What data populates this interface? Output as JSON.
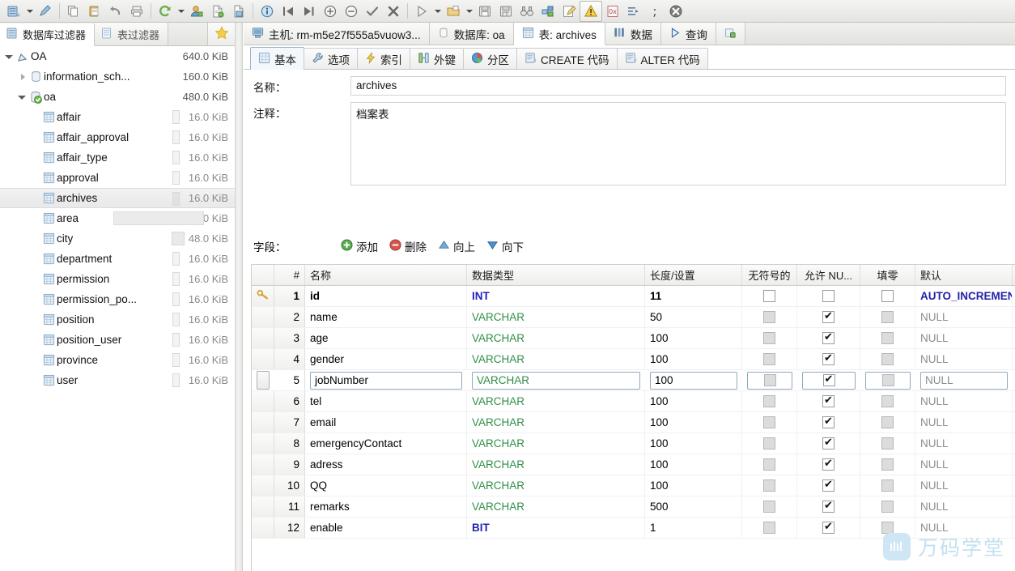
{
  "toolbar": {
    "items": [
      {
        "name": "open-table-icon",
        "glyph": "table"
      },
      {
        "name": "chevron-down-icon",
        "glyph": "caret"
      },
      {
        "name": "design-table-icon",
        "glyph": "pencil-table"
      },
      {
        "name": "separator",
        "glyph": "sep"
      },
      {
        "name": "copy-icon",
        "glyph": "copy"
      },
      {
        "name": "paste-icon",
        "glyph": "paste"
      },
      {
        "name": "undo-icon",
        "glyph": "undo"
      },
      {
        "name": "print-icon",
        "glyph": "print"
      },
      {
        "name": "separator",
        "glyph": "sep"
      },
      {
        "name": "refresh-icon",
        "glyph": "refresh"
      },
      {
        "name": "chevron-down-icon",
        "glyph": "caret"
      },
      {
        "name": "user-manage-icon",
        "glyph": "user"
      },
      {
        "name": "new-document-icon",
        "glyph": "newdoc"
      },
      {
        "name": "save-document-icon",
        "glyph": "savedoc"
      },
      {
        "name": "separator",
        "glyph": "sep"
      },
      {
        "name": "info-icon",
        "glyph": "info"
      },
      {
        "name": "first-record-icon",
        "glyph": "first"
      },
      {
        "name": "last-record-icon",
        "glyph": "last"
      },
      {
        "name": "add-record-icon",
        "glyph": "plus-circle"
      },
      {
        "name": "delete-record-icon",
        "glyph": "minus-circle"
      },
      {
        "name": "apply-changes-icon",
        "glyph": "check"
      },
      {
        "name": "cancel-changes-icon",
        "glyph": "cross"
      },
      {
        "name": "separator",
        "glyph": "sep"
      },
      {
        "name": "run-query-icon",
        "glyph": "play"
      },
      {
        "name": "chevron-down-icon",
        "glyph": "caret"
      },
      {
        "name": "load-query-icon",
        "glyph": "folder"
      },
      {
        "name": "chevron-down-icon",
        "glyph": "caret"
      },
      {
        "name": "save-icon",
        "glyph": "floppy"
      },
      {
        "name": "save-as-icon",
        "glyph": "floppy-as"
      },
      {
        "name": "find-icon",
        "glyph": "binocular"
      },
      {
        "name": "query-builder-icon",
        "glyph": "builder"
      },
      {
        "name": "edit-icon",
        "glyph": "edit"
      },
      {
        "name": "warning-icon",
        "glyph": "warning"
      },
      {
        "name": "hex-icon",
        "glyph": "hex"
      },
      {
        "name": "indent-icon",
        "glyph": "indent"
      },
      {
        "name": "semicolon-icon",
        "glyph": "semi"
      },
      {
        "name": "stop-icon",
        "glyph": "stop"
      }
    ]
  },
  "sidebar": {
    "filter_tabs": [
      {
        "label": "数据库过滤器",
        "icon": "database-filter-icon",
        "active": true
      },
      {
        "label": "表过滤器",
        "icon": "table-filter-icon",
        "active": false
      }
    ],
    "favorite_icon": "star-icon",
    "tree": [
      {
        "label": "OA",
        "size": "640.0 KiB",
        "indent": 0,
        "twist": "open",
        "icon": "connection-icon",
        "selected": false,
        "bar": "none"
      },
      {
        "label": "information_sch...",
        "size": "160.0 KiB",
        "indent": 1,
        "twist": "closed",
        "icon": "database-icon",
        "selected": false,
        "bar": "none"
      },
      {
        "label": "oa",
        "size": "480.0 KiB",
        "indent": 1,
        "twist": "open",
        "icon": "database-open-icon",
        "selected": false,
        "bar": "none"
      },
      {
        "label": "affair",
        "size": "16.0 KiB",
        "indent": 2,
        "twist": "none",
        "icon": "table-icon",
        "selected": false,
        "bar": "thin"
      },
      {
        "label": "affair_approval",
        "size": "16.0 KiB",
        "indent": 2,
        "twist": "none",
        "icon": "table-icon",
        "selected": false,
        "bar": "thin"
      },
      {
        "label": "affair_type",
        "size": "16.0 KiB",
        "indent": 2,
        "twist": "none",
        "icon": "table-icon",
        "selected": false,
        "bar": "thin"
      },
      {
        "label": "approval",
        "size": "16.0 KiB",
        "indent": 2,
        "twist": "none",
        "icon": "table-icon",
        "selected": false,
        "bar": "thin"
      },
      {
        "label": "archives",
        "size": "16.0 KiB",
        "indent": 2,
        "twist": "none",
        "icon": "table-icon",
        "selected": true,
        "bar": "thin"
      },
      {
        "label": "area",
        "size": "240.0 KiB",
        "indent": 2,
        "twist": "none",
        "icon": "table-icon",
        "selected": false,
        "bar": "hilite"
      },
      {
        "label": "city",
        "size": "48.0 KiB",
        "indent": 2,
        "twist": "none",
        "icon": "table-icon",
        "selected": false,
        "bar": "wide"
      },
      {
        "label": "department",
        "size": "16.0 KiB",
        "indent": 2,
        "twist": "none",
        "icon": "table-icon",
        "selected": false,
        "bar": "thin"
      },
      {
        "label": "permission",
        "size": "16.0 KiB",
        "indent": 2,
        "twist": "none",
        "icon": "table-icon",
        "selected": false,
        "bar": "thin"
      },
      {
        "label": "permission_po...",
        "size": "16.0 KiB",
        "indent": 2,
        "twist": "none",
        "icon": "table-icon",
        "selected": false,
        "bar": "thin"
      },
      {
        "label": "position",
        "size": "16.0 KiB",
        "indent": 2,
        "twist": "none",
        "icon": "table-icon",
        "selected": false,
        "bar": "thin"
      },
      {
        "label": "position_user",
        "size": "16.0 KiB",
        "indent": 2,
        "twist": "none",
        "icon": "table-icon",
        "selected": false,
        "bar": "thin"
      },
      {
        "label": "province",
        "size": "16.0 KiB",
        "indent": 2,
        "twist": "none",
        "icon": "table-icon",
        "selected": false,
        "bar": "thin"
      },
      {
        "label": "user",
        "size": "16.0 KiB",
        "indent": 2,
        "twist": "none",
        "icon": "table-icon",
        "selected": false,
        "bar": "thin"
      }
    ]
  },
  "object_tabs": [
    {
      "label": "主机: rm-m5e27f555a5vuow3...",
      "icon": "host-icon",
      "active": false
    },
    {
      "label": "数据库: oa",
      "icon": "database-icon",
      "active": false
    },
    {
      "label": "表: archives",
      "icon": "table-icon",
      "active": true
    },
    {
      "label": "数据",
      "icon": "data-icon",
      "active": false
    },
    {
      "label": "查询",
      "icon": "query-icon",
      "active": false
    },
    {
      "label": "",
      "icon": "new-tab-icon",
      "active": false
    }
  ],
  "designer_tabs": [
    {
      "label": "基本",
      "icon": "grid-icon",
      "active": true
    },
    {
      "label": "选项",
      "icon": "wrench-icon",
      "active": false
    },
    {
      "label": "索引",
      "icon": "lightning-icon",
      "active": false
    },
    {
      "label": "外键",
      "icon": "key-link-icon",
      "active": false
    },
    {
      "label": "分区",
      "icon": "pie-icon",
      "active": false
    },
    {
      "label": "CREATE 代码",
      "icon": "code-icon",
      "active": false
    },
    {
      "label": "ALTER 代码",
      "icon": "code-icon",
      "active": false
    }
  ],
  "form": {
    "name_label": "名称：",
    "name_value": "archives",
    "comment_label": "注释：",
    "comment_value": "档案表"
  },
  "fields_toolbar": {
    "label": "字段：",
    "buttons": [
      {
        "label": "添加",
        "icon": "add-icon"
      },
      {
        "label": "删除",
        "icon": "remove-icon"
      },
      {
        "label": "向上",
        "icon": "move-up-icon"
      },
      {
        "label": "向下",
        "icon": "move-down-icon"
      }
    ]
  },
  "grid": {
    "columns": [
      "",
      "#",
      "名称",
      "数据类型",
      "长度/设置",
      "无符号的",
      "允许 NU...",
      "填零",
      "默认"
    ],
    "rows": [
      {
        "key": true,
        "num": "1",
        "name": "id",
        "type": "INT",
        "type_kind": "int",
        "length": "11",
        "unsigned": "off",
        "nullable": "off",
        "zerofill": "off",
        "default": "AUTO_INCREMENT",
        "default_kind": "autoinc",
        "bold": true,
        "editing": false
      },
      {
        "key": false,
        "num": "2",
        "name": "name",
        "type": "VARCHAR",
        "type_kind": "varchar",
        "length": "50",
        "unsigned": "disabled",
        "nullable": "checked",
        "zerofill": "disabled",
        "default": "NULL",
        "default_kind": "null",
        "bold": false,
        "editing": false
      },
      {
        "key": false,
        "num": "3",
        "name": "age",
        "type": "VARCHAR",
        "type_kind": "varchar",
        "length": "100",
        "unsigned": "disabled",
        "nullable": "checked",
        "zerofill": "disabled",
        "default": "NULL",
        "default_kind": "null",
        "bold": false,
        "editing": false
      },
      {
        "key": false,
        "num": "4",
        "name": "gender",
        "type": "VARCHAR",
        "type_kind": "varchar",
        "length": "100",
        "unsigned": "disabled",
        "nullable": "checked",
        "zerofill": "disabled",
        "default": "NULL",
        "default_kind": "null",
        "bold": false,
        "editing": false
      },
      {
        "key": false,
        "num": "5",
        "name": "jobNumber",
        "type": "VARCHAR",
        "type_kind": "varchar",
        "length": "100",
        "unsigned": "disabled",
        "nullable": "checked",
        "zerofill": "disabled",
        "default": "NULL",
        "default_kind": "null",
        "bold": false,
        "editing": true
      },
      {
        "key": false,
        "num": "6",
        "name": "tel",
        "type": "VARCHAR",
        "type_kind": "varchar",
        "length": "100",
        "unsigned": "disabled",
        "nullable": "checked",
        "zerofill": "disabled",
        "default": "NULL",
        "default_kind": "null",
        "bold": false,
        "editing": false
      },
      {
        "key": false,
        "num": "7",
        "name": "email",
        "type": "VARCHAR",
        "type_kind": "varchar",
        "length": "100",
        "unsigned": "disabled",
        "nullable": "checked",
        "zerofill": "disabled",
        "default": "NULL",
        "default_kind": "null",
        "bold": false,
        "editing": false
      },
      {
        "key": false,
        "num": "8",
        "name": "emergencyContact",
        "type": "VARCHAR",
        "type_kind": "varchar",
        "length": "100",
        "unsigned": "disabled",
        "nullable": "checked",
        "zerofill": "disabled",
        "default": "NULL",
        "default_kind": "null",
        "bold": false,
        "editing": false
      },
      {
        "key": false,
        "num": "9",
        "name": "adress",
        "type": "VARCHAR",
        "type_kind": "varchar",
        "length": "100",
        "unsigned": "disabled",
        "nullable": "checked",
        "zerofill": "disabled",
        "default": "NULL",
        "default_kind": "null",
        "bold": false,
        "editing": false
      },
      {
        "key": false,
        "num": "10",
        "name": "QQ",
        "type": "VARCHAR",
        "type_kind": "varchar",
        "length": "100",
        "unsigned": "disabled",
        "nullable": "checked",
        "zerofill": "disabled",
        "default": "NULL",
        "default_kind": "null",
        "bold": false,
        "editing": false
      },
      {
        "key": false,
        "num": "11",
        "name": "remarks",
        "type": "VARCHAR",
        "type_kind": "varchar",
        "length": "500",
        "unsigned": "disabled",
        "nullable": "checked",
        "zerofill": "disabled",
        "default": "NULL",
        "default_kind": "null",
        "bold": false,
        "editing": false
      },
      {
        "key": false,
        "num": "12",
        "name": "enable",
        "type": "BIT",
        "type_kind": "int",
        "length": "1",
        "unsigned": "disabled",
        "nullable": "checked",
        "zerofill": "disabled",
        "default": "NULL",
        "default_kind": "null",
        "bold": false,
        "editing": false
      }
    ]
  },
  "watermark": {
    "text": "万码学堂",
    "logo_icon": "wanma-logo-icon"
  },
  "colors": {
    "accent_blue": "#2222bb",
    "type_green": "#2f8f46",
    "null_gray": "#8d8d8d",
    "watermark": "#c3e0f0"
  }
}
